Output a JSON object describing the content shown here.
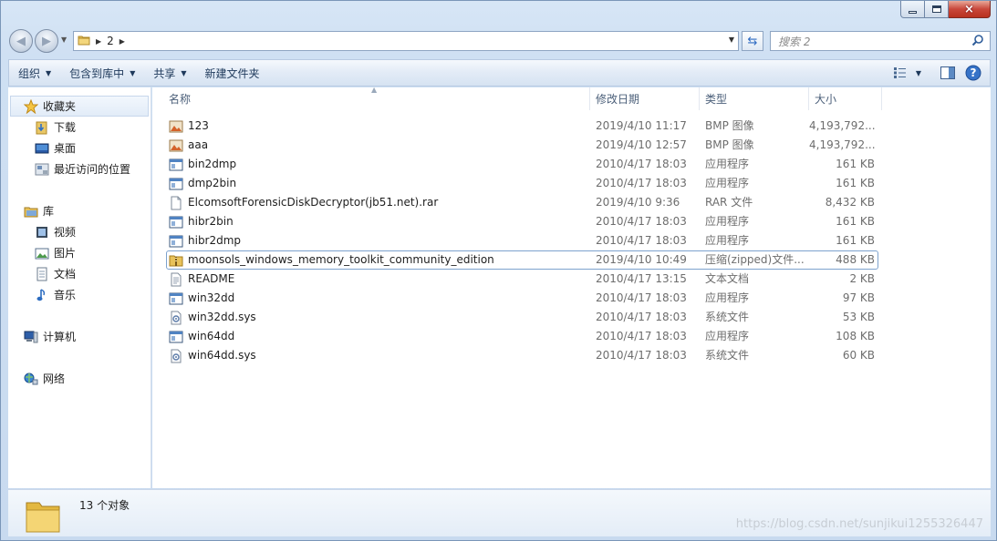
{
  "window": {
    "controls": {
      "minimize": "minimize",
      "maximize": "maximize",
      "close": "×"
    }
  },
  "address": {
    "segment": "2",
    "search_placeholder": "搜索 2"
  },
  "toolbar": {
    "organize": "组织",
    "include_in_library": "包含到库中",
    "share": "共享",
    "new_folder": "新建文件夹"
  },
  "nav": {
    "favorites": "收藏夹",
    "downloads": "下载",
    "desktop": "桌面",
    "recent": "最近访问的位置",
    "libraries": "库",
    "videos": "视频",
    "pictures": "图片",
    "documents": "文档",
    "music": "音乐",
    "computer": "计算机",
    "network": "网络"
  },
  "columns": {
    "name": "名称",
    "date": "修改日期",
    "type": "类型",
    "size": "大小"
  },
  "files": [
    {
      "name": "123",
      "date": "2019/4/10 11:17",
      "type": "BMP 图像",
      "size": "4,193,792...",
      "icon": "bmp-icon"
    },
    {
      "name": "aaa",
      "date": "2019/4/10 12:57",
      "type": "BMP 图像",
      "size": "4,193,792...",
      "icon": "bmp-icon"
    },
    {
      "name": "bin2dmp",
      "date": "2010/4/17 18:03",
      "type": "应用程序",
      "size": "161 KB",
      "icon": "exe-icon"
    },
    {
      "name": "dmp2bin",
      "date": "2010/4/17 18:03",
      "type": "应用程序",
      "size": "161 KB",
      "icon": "exe-icon"
    },
    {
      "name": "ElcomsoftForensicDiskDecryptor(jb51.net).rar",
      "date": "2019/4/10 9:36",
      "type": "RAR 文件",
      "size": "8,432 KB",
      "icon": "file-icon"
    },
    {
      "name": "hibr2bin",
      "date": "2010/4/17 18:03",
      "type": "应用程序",
      "size": "161 KB",
      "icon": "exe-icon"
    },
    {
      "name": "hibr2dmp",
      "date": "2010/4/17 18:03",
      "type": "应用程序",
      "size": "161 KB",
      "icon": "exe-icon"
    },
    {
      "name": "moonsols_windows_memory_toolkit_community_edition",
      "date": "2019/4/10 10:49",
      "type": "压缩(zipped)文件...",
      "size": "488 KB",
      "icon": "zip-folder-icon"
    },
    {
      "name": "README",
      "date": "2010/4/17 13:15",
      "type": "文本文档",
      "size": "2 KB",
      "icon": "text-file-icon"
    },
    {
      "name": "win32dd",
      "date": "2010/4/17 18:03",
      "type": "应用程序",
      "size": "97 KB",
      "icon": "exe-icon"
    },
    {
      "name": "win32dd.sys",
      "date": "2010/4/17 18:03",
      "type": "系统文件",
      "size": "53 KB",
      "icon": "sys-file-icon"
    },
    {
      "name": "win64dd",
      "date": "2010/4/17 18:03",
      "type": "应用程序",
      "size": "108 KB",
      "icon": "exe-icon"
    },
    {
      "name": "win64dd.sys",
      "date": "2010/4/17 18:03",
      "type": "系统文件",
      "size": "60 KB",
      "icon": "sys-file-icon"
    }
  ],
  "status": {
    "item_count": "13 个对象",
    "watermark": "https://blog.csdn.net/sunjikui1255326447"
  }
}
